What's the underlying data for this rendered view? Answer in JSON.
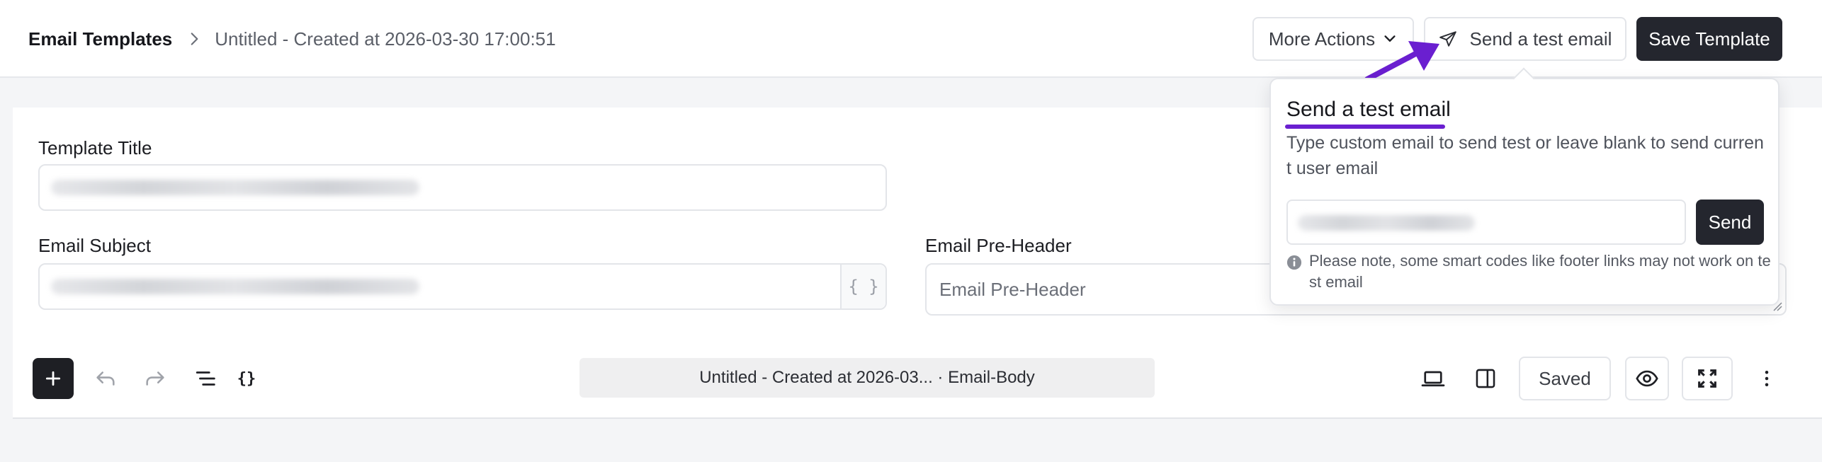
{
  "header": {
    "breadcrumb_root": "Email Templates",
    "breadcrumb_current": "Untitled - Created at 2026-03-30 17:00:51",
    "more_actions_label": "More Actions",
    "send_test_label": "Send a test email",
    "save_template_label": "Save Template"
  },
  "form": {
    "template_title_label": "Template Title",
    "email_subject_label": "Email Subject",
    "braces_label": "{ }",
    "pre_header_label": "Email Pre-Header",
    "pre_header_placeholder": "Email Pre-Header"
  },
  "editor": {
    "inserter_icon": "plus-icon",
    "undo_icon": "undo-icon",
    "redo_icon": "redo-icon",
    "outline_icon": "list-view-icon",
    "smartcode_label": "{}",
    "document_title": "Untitled - Created at 2026-03... · Email-Body",
    "desktop_icon": "laptop-icon",
    "sidebar_icon": "sidebar-toggle-icon",
    "saved_label": "Saved",
    "preview_icon": "eye-icon",
    "fullscreen_icon": "fullscreen-icon",
    "options_icon": "vertical-dots-icon"
  },
  "popover": {
    "title": "Send a test email",
    "description": "Type custom email to send test or leave blank to send current user email",
    "send_label": "Send",
    "note": "Please note, some smart codes like footer links may not work on test email"
  },
  "colors": {
    "dark_button": "#24262e",
    "annotation_purple": "#6a1fd0",
    "border": "#e3e5e9",
    "page_bg": "#f4f5f7"
  }
}
